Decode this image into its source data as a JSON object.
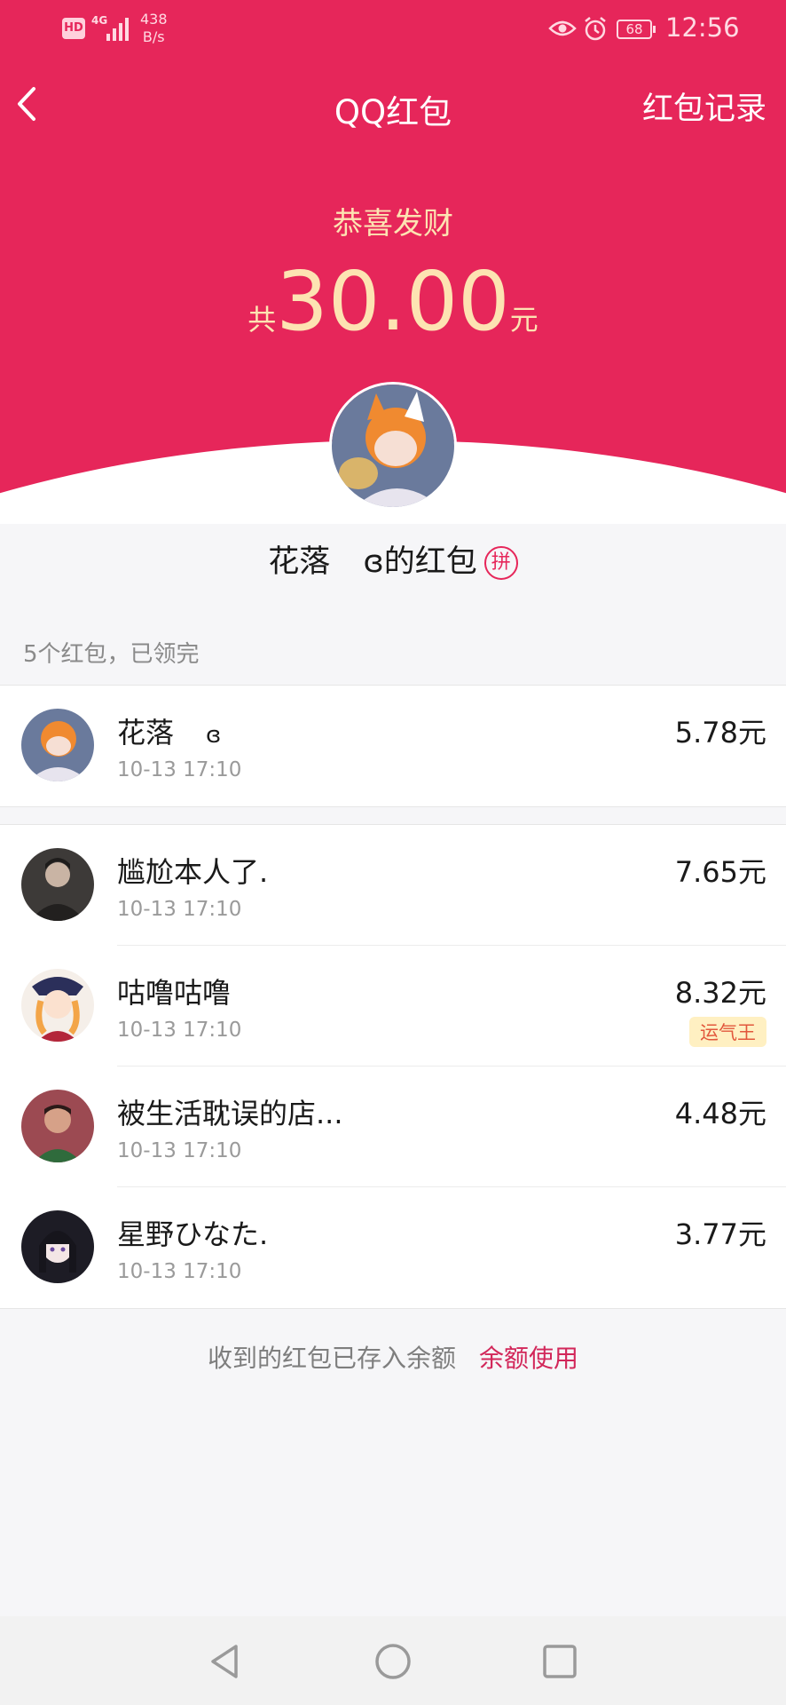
{
  "status_bar": {
    "hd": "HD",
    "network": "4G",
    "speed_value": "438",
    "speed_unit": "B/s",
    "battery": "68",
    "time": "12:56"
  },
  "nav": {
    "title": "QQ红包",
    "right_link": "红包记录"
  },
  "hero": {
    "greeting": "恭喜发财",
    "amount_prefix": "共",
    "amount": "30.00",
    "amount_unit": "元"
  },
  "sender": {
    "name_part1": "花落",
    "name_glyph": "ɞ",
    "name_suffix": "的红包",
    "badge": "拼"
  },
  "summary": "5个红包，已领完",
  "my_receipt": {
    "name": "花落",
    "name_glyph": "ɞ",
    "time": "10-13 17:10",
    "amount": "5.78元"
  },
  "receipts": [
    {
      "name": "尴尬本人了.",
      "time": "10-13 17:10",
      "amount": "7.65元",
      "badge": ""
    },
    {
      "name": "咕噜咕噜",
      "time": "10-13 17:10",
      "amount": "8.32元",
      "badge": "运气王"
    },
    {
      "name": "被生活耽误的店...",
      "time": "10-13 17:10",
      "amount": "4.48元",
      "badge": ""
    },
    {
      "name": "星野ひなた.",
      "time": "10-13 17:10",
      "amount": "3.77元",
      "badge": ""
    }
  ],
  "footer": {
    "text": "收到的红包已存入余额",
    "link": "余额使用"
  },
  "colors": {
    "header_red": "#e6265a",
    "gold_text": "#fde3b2",
    "link_red": "#d2275a",
    "lucky_bg": "#fff0c2"
  },
  "icons": [
    "back-chevron-icon",
    "eye-icon",
    "alarm-icon",
    "battery-icon",
    "back-triangle-icon",
    "home-circle-icon",
    "recent-square-icon"
  ]
}
